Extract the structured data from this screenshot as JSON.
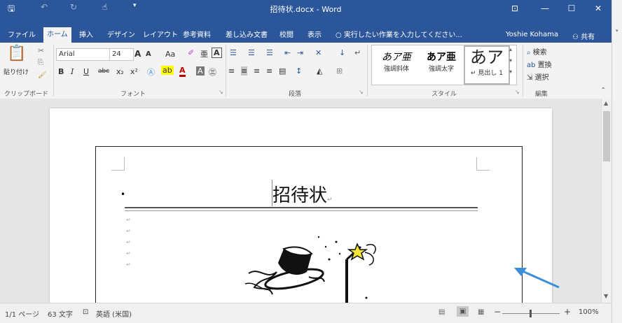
{
  "window": {
    "title": "招待状.docx - Word",
    "minimize": "—",
    "maximize": "☐",
    "close": "✕",
    "ribbon_display": "⊡"
  },
  "quick_access": {
    "save": "🖫",
    "undo": "↶",
    "redo": "↻",
    "touch": "☝",
    "customize": "▾"
  },
  "tabs": [
    "ファイル",
    "ホーム",
    "挿入",
    "デザイン",
    "レイアウト",
    "参考資料",
    "差し込み文書",
    "校閲",
    "表示"
  ],
  "tell_me": "実行したい作業を入力してください...",
  "user": "Yoshie Kohama",
  "share": "共有",
  "ribbon": {
    "paste_label": "貼り付け",
    "font_name": "Arial",
    "font_size": "24",
    "grow": "A",
    "shrink": "A",
    "case": "Aa",
    "bold": "B",
    "italic": "I",
    "underline": "U",
    "strike": "abc",
    "sub": "x₂",
    "sup": "x²",
    "groups": {
      "clipboard": "クリップボード",
      "font": "フォント",
      "paragraph": "段落",
      "styles": "スタイル",
      "editing": "編集"
    },
    "styles": [
      {
        "preview": "あア亜",
        "label": "強調斜体"
      },
      {
        "preview": "あア亜",
        "label": "強調太字"
      },
      {
        "preview": "あア",
        "label": "↵ 見出し 1"
      }
    ],
    "editing": {
      "find": "検索",
      "replace": "置換",
      "select": "選択"
    }
  },
  "document": {
    "title_text": "招待状"
  },
  "status": {
    "page": "1/1 ページ",
    "words": "63 文字",
    "language": "英語 (米国)",
    "zoom": "100%",
    "zoom_minus": "−",
    "zoom_plus": "+"
  }
}
